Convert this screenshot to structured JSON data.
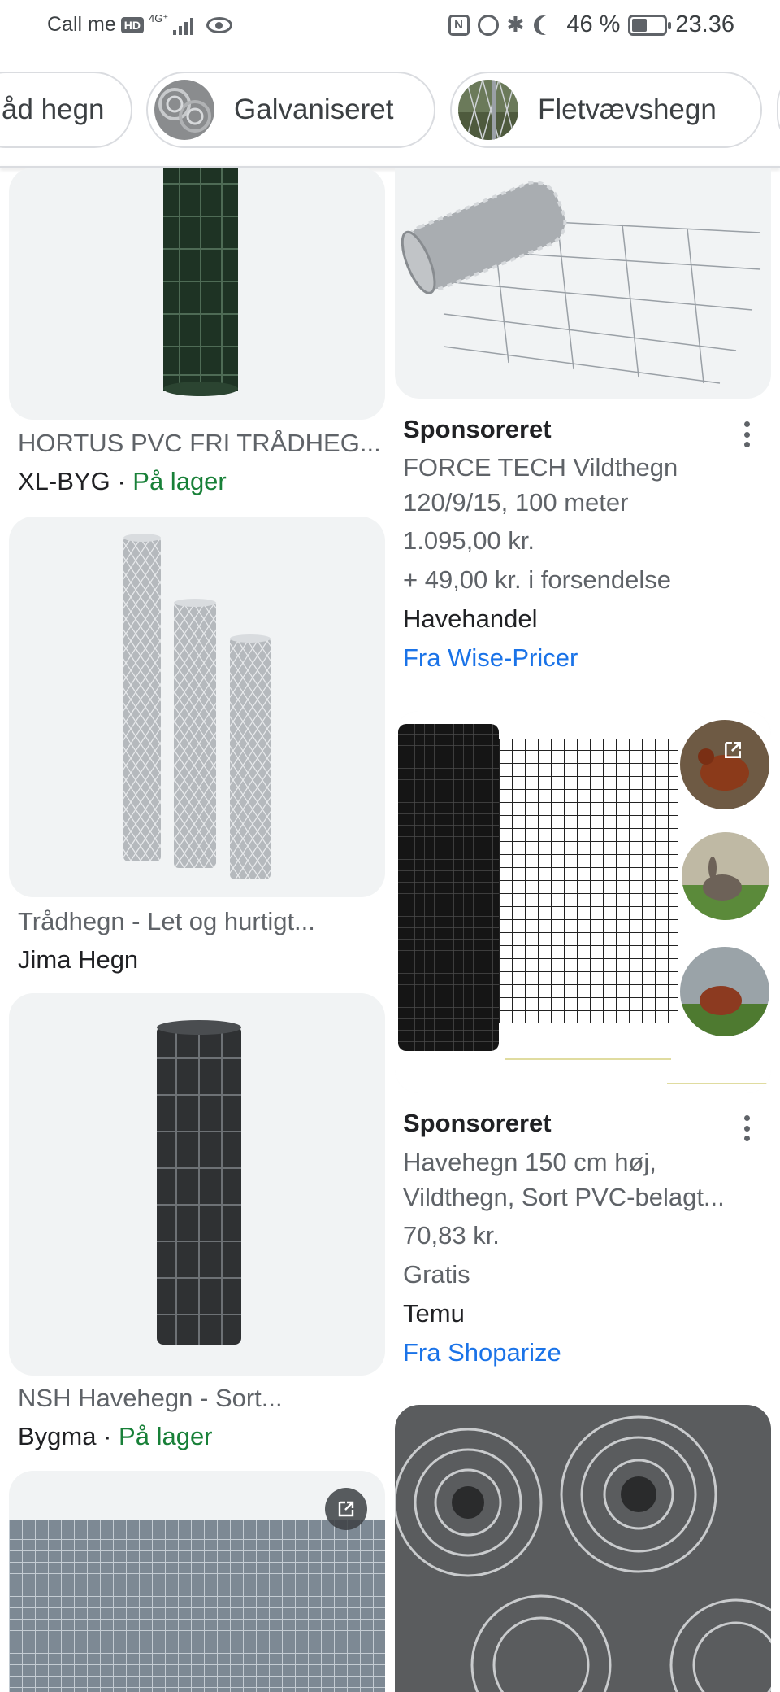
{
  "status_bar": {
    "carrier": "Call me",
    "hd": "HD",
    "network": "4G⁺",
    "nfc": "N",
    "battery": "46 %",
    "time": "23.36"
  },
  "chips": [
    {
      "label": "åd hegn"
    },
    {
      "label": "Galvaniseret"
    },
    {
      "label": "Fletvævshegn"
    }
  ],
  "results": {
    "left": [
      {
        "title": "HORTUS PVC FRI TRÅDHEG...",
        "seller": "XL-BYG",
        "separator": " · ",
        "stock": "På lager"
      },
      {
        "title": "Trådhegn - Let og hurtigt...",
        "seller": "Jima Hegn"
      },
      {
        "title": "NSH Havehegn - Sort...",
        "seller": "Bygma",
        "separator": " · ",
        "stock": "På lager"
      }
    ],
    "right": [
      {
        "sponsored": "Sponsoreret",
        "title_line1": "FORCE TECH Vildthegn",
        "title_line2": "120/9/15, 100 meter",
        "price": "1.095,00 kr.",
        "shipping": "+ 49,00 kr. i forsendelse",
        "seller": "Havehandel",
        "source": "Fra Wise-Pricer"
      },
      {
        "sponsored": "Sponsoreret",
        "title_line1": "Havehegn 150 cm høj,",
        "title_line2": "Vildthegn, Sort PVC-belagt...",
        "price": "70,83 kr.",
        "shipping": "Gratis",
        "seller": "Temu",
        "source": "Fra Shoparize"
      }
    ]
  }
}
